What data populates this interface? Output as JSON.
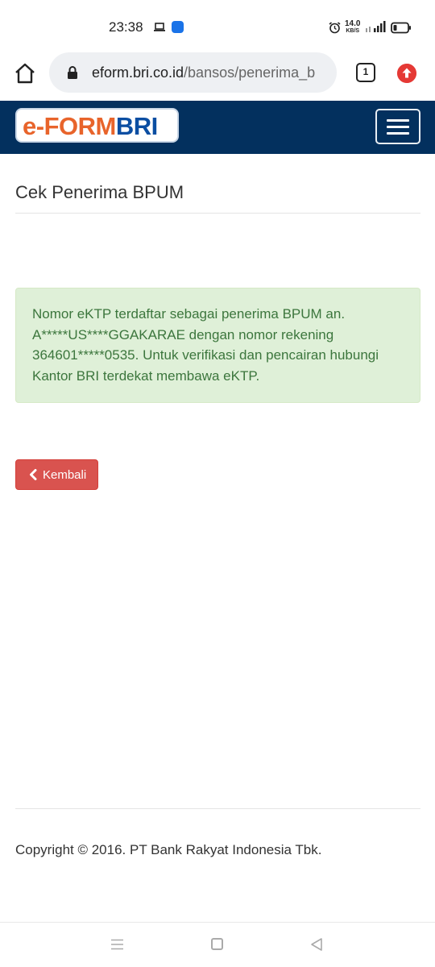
{
  "status_bar": {
    "time": "23:38",
    "net_speed": "14.0",
    "net_unit": "KB/S",
    "icons": [
      "laptop-icon",
      "app-notification-icon",
      "alarm-icon",
      "signal-icon",
      "battery-icon"
    ]
  },
  "browser": {
    "url_domain": "eform.bri.co.id",
    "url_path": "/bansos/penerima_b",
    "tab_count": "1",
    "icons": [
      "home-icon",
      "lock-icon",
      "tabs-icon",
      "update-icon"
    ]
  },
  "header": {
    "logo_prefix": "e-FORM",
    "logo_brand": "BRI",
    "menu_icon": "hamburger-icon"
  },
  "main": {
    "title": "Cek Penerima BPUM",
    "alert_message": "Nomor eKTP terdaftar sebagai penerima BPUM an. A*****US****GGAKARAE dengan nomor rekening 364601*****0535. Untuk verifikasi dan pencairan hubungi Kantor BRI terdekat membawa eKTP.",
    "back_button_label": "Kembali"
  },
  "footer": {
    "copyright": "Copyright © 2016. PT Bank Rakyat Indonesia Tbk."
  },
  "colors": {
    "navbar": "#03305e",
    "alert_bg": "#dff0d8",
    "alert_text": "#3c763d",
    "button_danger": "#d9534f",
    "logo_orange": "#e8642b",
    "logo_blue": "#0b4ea2"
  }
}
